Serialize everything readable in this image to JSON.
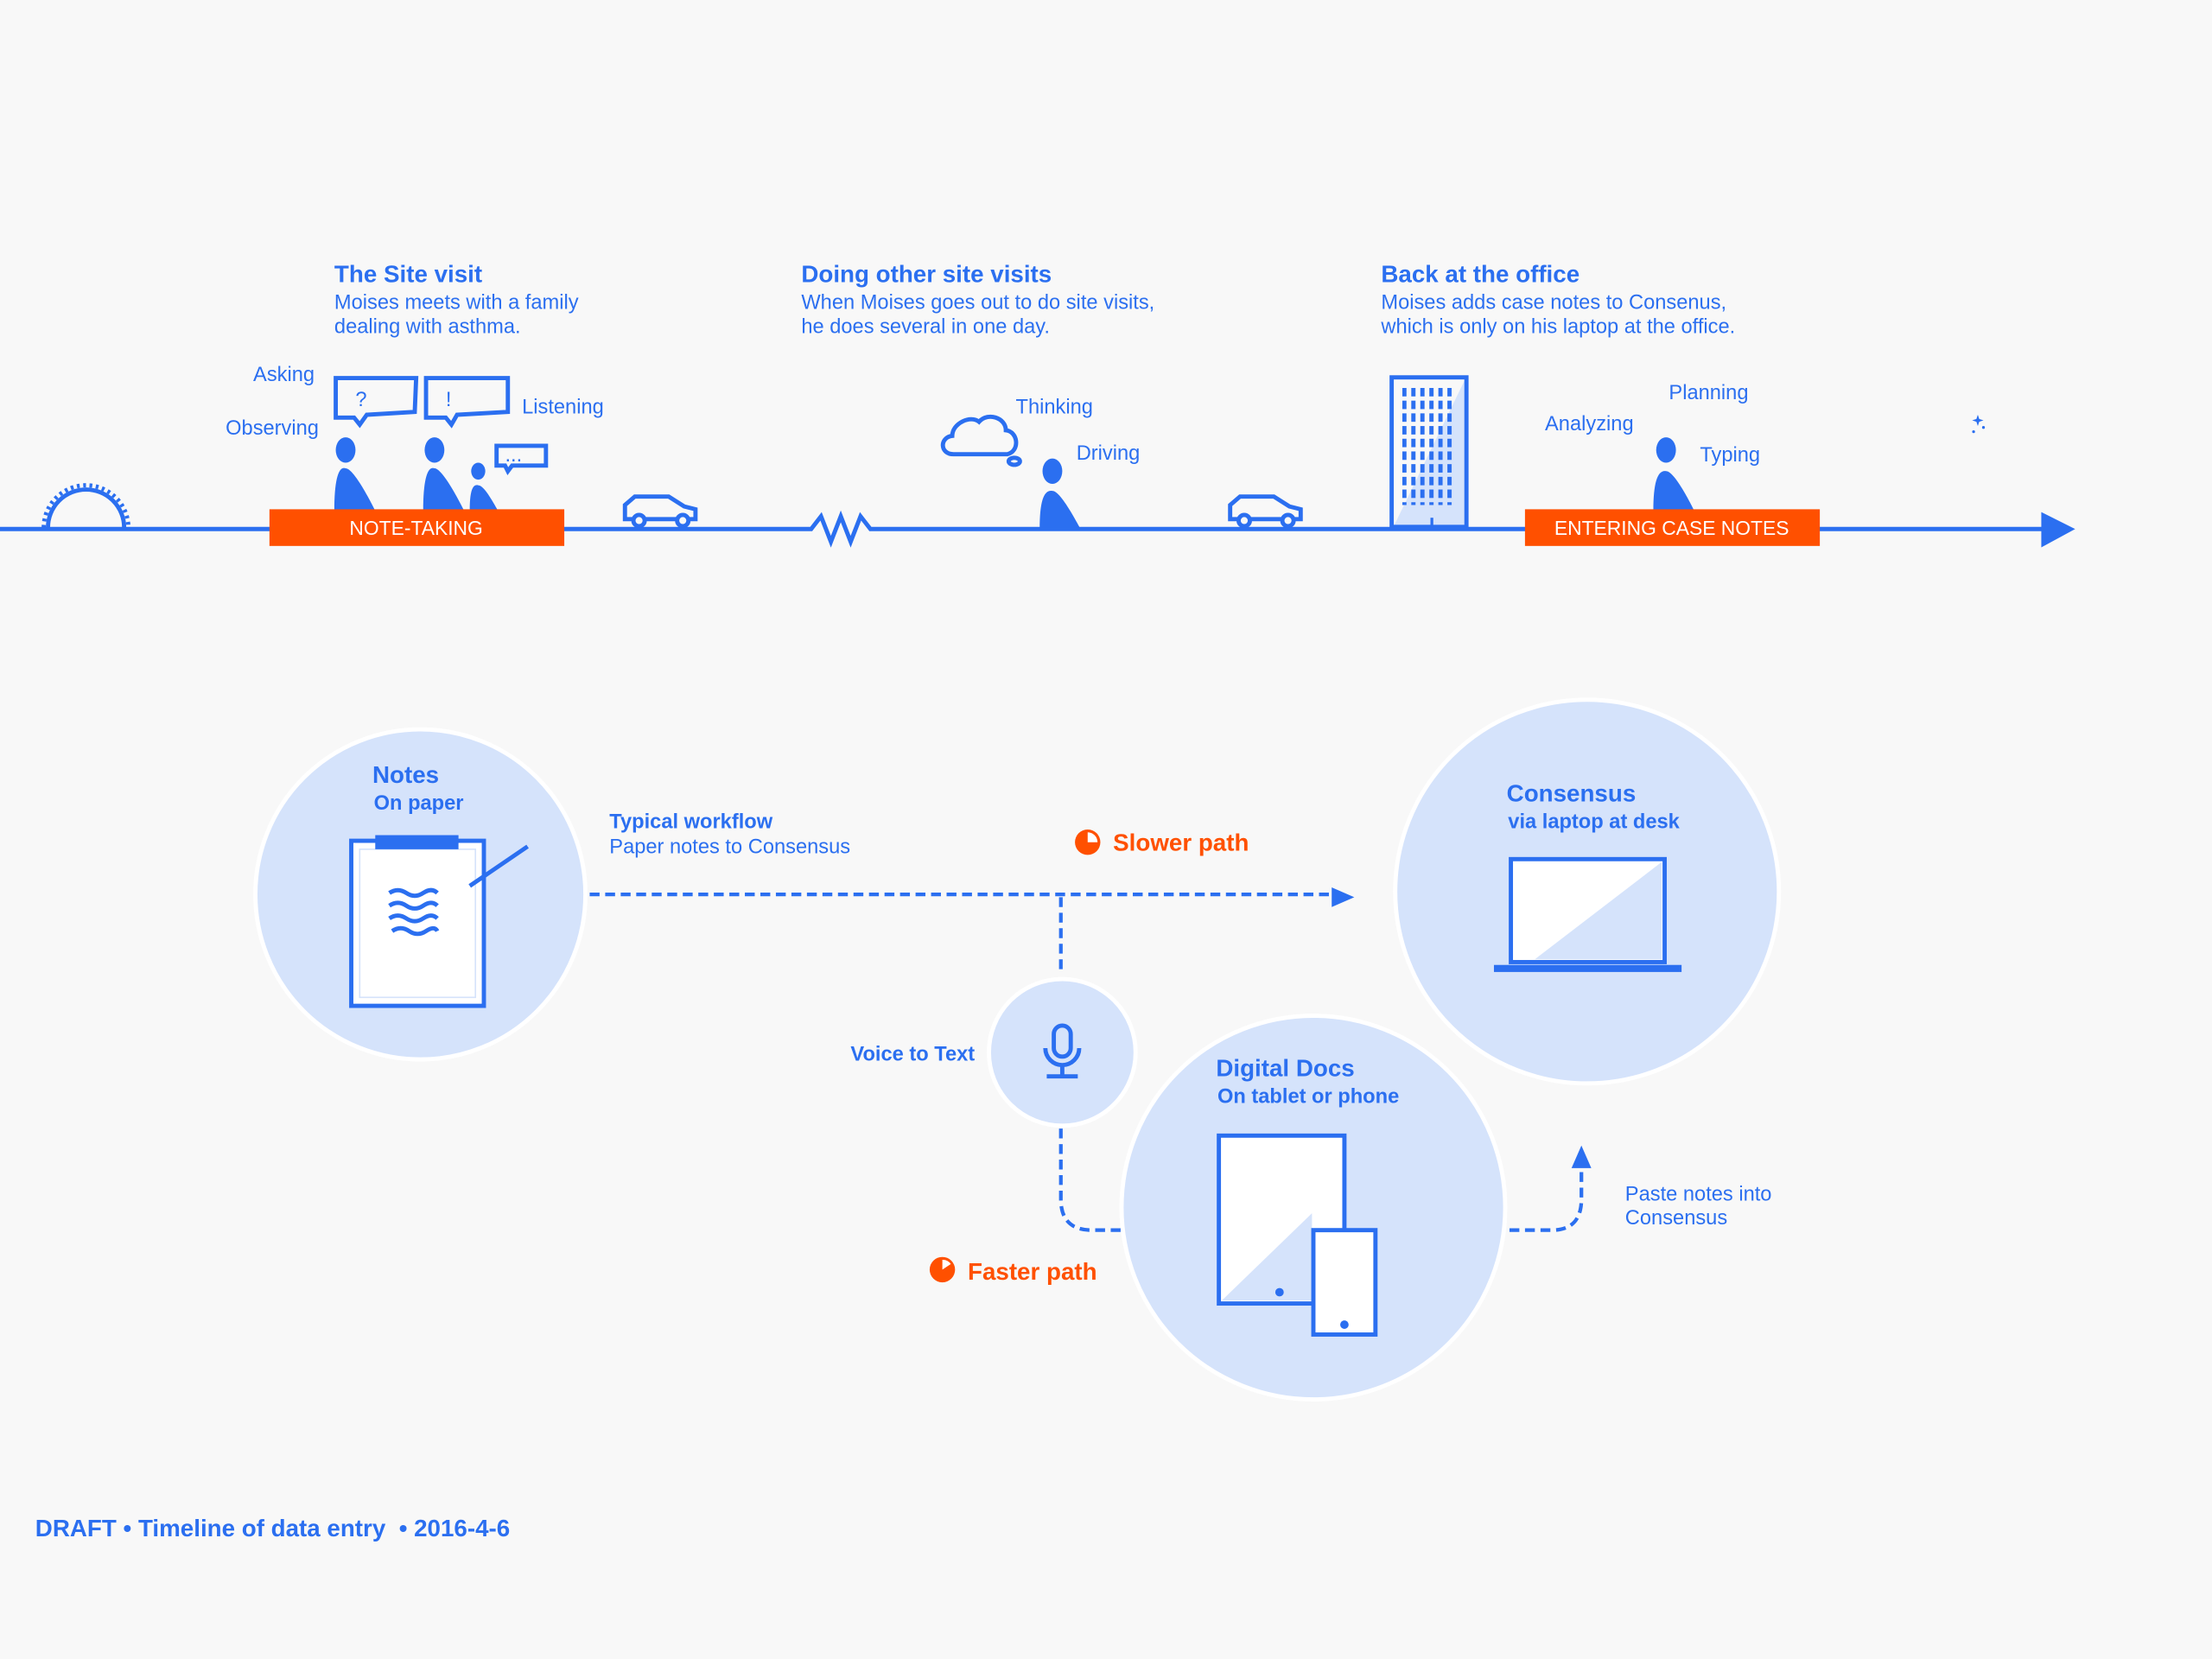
{
  "colors": {
    "accent": "#2b6ff0",
    "highlight": "#ff5000",
    "circle_fill": "#d5e3fb",
    "background": "#f8f8f8"
  },
  "timeline": {
    "sections": [
      {
        "title": "The Site visit",
        "lines": [
          "Moises meets with a family",
          "dealing with asthma."
        ]
      },
      {
        "title": "Doing other site visits",
        "lines": [
          "When Moises goes out to do site visits,",
          "he does several in one day."
        ]
      },
      {
        "title": "Back at the office",
        "lines": [
          "Moises adds case notes to Consenus,",
          "which is only on his laptop at the office."
        ]
      }
    ],
    "activities": {
      "asking": "Asking",
      "observing": "Observing",
      "listening": "Listening",
      "thinking": "Thinking",
      "driving": "Driving",
      "analyzing": "Analyzing",
      "planning": "Planning",
      "typing": "Typing"
    },
    "bubbles": {
      "question": "?",
      "exclaim": "!",
      "ellipsis": "..."
    },
    "badges": {
      "note_taking": "NOTE-TAKING",
      "entering": "ENTERING CASE NOTES"
    },
    "icons": [
      "sunrise-icon",
      "person-icon",
      "speech-bubble-icon",
      "car-icon",
      "zigzag-break-icon",
      "cloud-icon",
      "building-icon",
      "moon-icon"
    ]
  },
  "workflow": {
    "notes": {
      "title": "Notes",
      "subtitle": "On paper"
    },
    "typical": {
      "title": "Typical workflow",
      "subtitle": "Paper notes to Consensus"
    },
    "slower": "Slower path",
    "consensus": {
      "title": "Consensus",
      "subtitle": "via laptop at desk"
    },
    "voice": "Voice to Text",
    "digital": {
      "title": "Digital Docs",
      "subtitle": "On tablet or phone"
    },
    "faster": "Faster path",
    "paste": [
      "Paste notes into",
      "Consensus"
    ]
  },
  "footer": "DRAFT • Timeline of data entry  • 2016-4-6"
}
